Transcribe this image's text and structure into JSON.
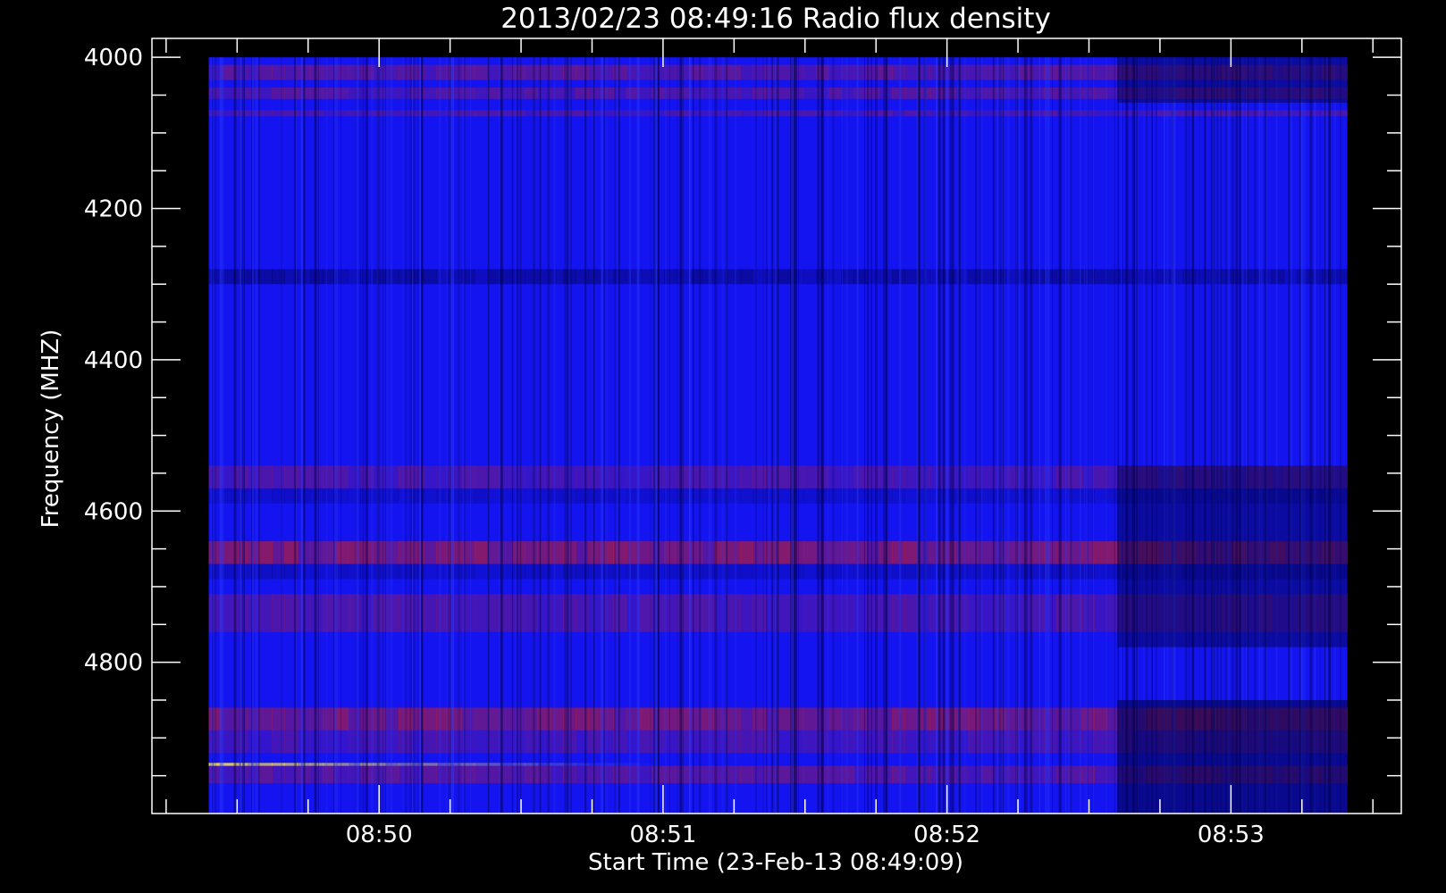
{
  "chart_data": {
    "type": "heatmap",
    "title": "2013/02/23 08:49:16 Radio flux density",
    "xlabel": "Start Time (23-Feb-13 08:49:09)",
    "ylabel": "Frequency (MHZ)",
    "x_ticks": [
      "08:50",
      "08:51",
      "08:52",
      "08:53"
    ],
    "y_ticks": [
      4000,
      4200,
      4400,
      4600,
      4800
    ],
    "y_minor_step": 50,
    "x_minor_per_major": 3,
    "y_range": [
      3975,
      5000
    ],
    "data_freq_range": [
      4000,
      5000
    ],
    "x_range_minutes": [
      -0.8,
      3.6
    ],
    "data_time_range_minutes": [
      -0.6,
      3.41
    ],
    "colors": {
      "background": "#000000",
      "low": "#000040",
      "base": "#1414f0",
      "high": "#c81e1e",
      "peak": "#ffe650",
      "axes": "#ffffff"
    },
    "bands": [
      {
        "freq": [
          4010,
          4030
        ],
        "intensity": 0.55
      },
      {
        "freq": [
          4040,
          4055
        ],
        "intensity": 0.5
      },
      {
        "freq": [
          4070,
          4078
        ],
        "intensity": 0.45
      },
      {
        "freq": [
          4280,
          4300
        ],
        "intensity": -0.6
      },
      {
        "freq": [
          4540,
          4570
        ],
        "intensity": 0.45
      },
      {
        "freq": [
          4570,
          4590
        ],
        "intensity": -0.3
      },
      {
        "freq": [
          4640,
          4670
        ],
        "intensity": 0.85
      },
      {
        "freq": [
          4670,
          4690
        ],
        "intensity": -0.35
      },
      {
        "freq": [
          4710,
          4760
        ],
        "intensity": 0.45
      },
      {
        "freq": [
          4860,
          4890
        ],
        "intensity": 0.8
      },
      {
        "freq": [
          4890,
          4920
        ],
        "intensity": 0.4
      },
      {
        "freq": [
          4933,
          4937
        ],
        "intensity": 1.0
      },
      {
        "freq": [
          4937,
          4960
        ],
        "intensity": 0.55
      }
    ]
  }
}
